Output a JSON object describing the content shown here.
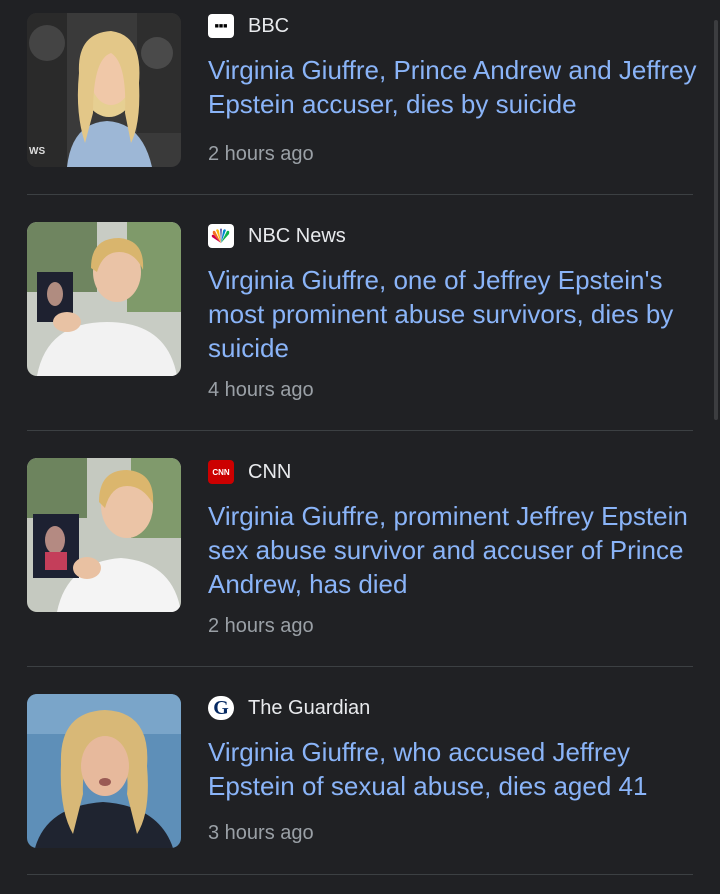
{
  "articles": [
    {
      "source": "BBC",
      "headline": "Virginia Giuffre, Prince Andrew and Jeffrey Epstein accuser, dies by suicide",
      "time": "2 hours ago",
      "logo_text": "■■■",
      "thumb_overlay": "WS"
    },
    {
      "source": "NBC News",
      "headline": "Virginia Giuffre, one of Jeffrey Epstein's most prominent abuse survivors, dies by suicide",
      "time": "4 hours ago"
    },
    {
      "source": "CNN",
      "headline": "Virginia Giuffre, prominent Jeffrey Epstein sex abuse survivor and accuser of Prince Andrew, has died",
      "time": "2 hours ago",
      "logo_text": "CNN"
    },
    {
      "source": "The Guardian",
      "headline": "Virginia Giuffre, who accused Jeffrey Epstein of sexual abuse, dies aged 41",
      "time": "3 hours ago",
      "logo_text": "G"
    }
  ],
  "colors": {
    "background": "#202124",
    "headline": "#8ab4f8",
    "source": "#e8eaed",
    "time": "#9aa0a6",
    "divider": "#3c4043",
    "cnn_red": "#cc0000"
  }
}
